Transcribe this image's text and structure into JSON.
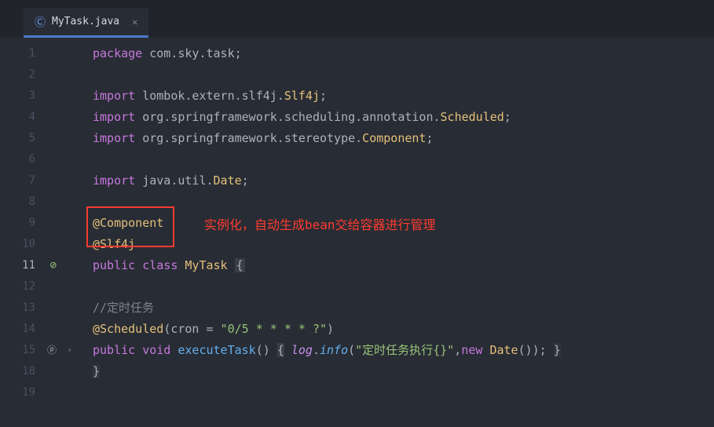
{
  "tab": {
    "icon_label": "Ⓒ",
    "filename": "MyTask.java",
    "close_label": "✕"
  },
  "gutter": {
    "lines": [
      "1",
      "2",
      "3",
      "4",
      "5",
      "6",
      "7",
      "8",
      "9",
      "10",
      "11",
      "12",
      "13",
      "14",
      "15",
      "18",
      "19"
    ]
  },
  "annotation": {
    "text": "实例化，自动生成bean交给容器进行管理"
  },
  "code": {
    "l1_kw": "package",
    "l1_rest": " com.sky.task;",
    "l3_kw": "import",
    "l3_pkg": " lombok.extern.slf4j.",
    "l3_cls": "Slf4j",
    "l4_kw": "import",
    "l4_pkg": " org.springframework.scheduling.annotation.",
    "l4_cls": "Scheduled",
    "l5_kw": "import",
    "l5_pkg": " org.springframework.stereotype.",
    "l5_cls": "Component",
    "l7_kw": "import",
    "l7_pkg": " java.util.",
    "l7_cls": "Date",
    "l9_ann": "@Component",
    "l10_ann": "@Slf4j",
    "l11_pub": "public ",
    "l11_class": "class ",
    "l11_name": "MyTask ",
    "l11_brace": "{",
    "l13_cmt": "//定时任务",
    "l14_ann": "@Scheduled",
    "l14_open": "(",
    "l14_param": "cron = ",
    "l14_str": "\"0/5 * * * * ?\"",
    "l14_close": ")",
    "l15_pub": "public ",
    "l15_void": "void ",
    "l15_method": "executeTask",
    "l15_parens": "() ",
    "l15_open_brace": "{",
    "l15_log": " log",
    "l15_dot": ".",
    "l15_info": "info",
    "l15_info_open": "(",
    "l15_str": "\"定时任务执行{}\"",
    "l15_comma": ",",
    "l15_new": "new ",
    "l15_date": "Date",
    "l15_date_parens": "()",
    "l15_close_paren": ")",
    "l15_semi": "; ",
    "l15_close_brace": "}",
    "l18_brace": "}"
  }
}
